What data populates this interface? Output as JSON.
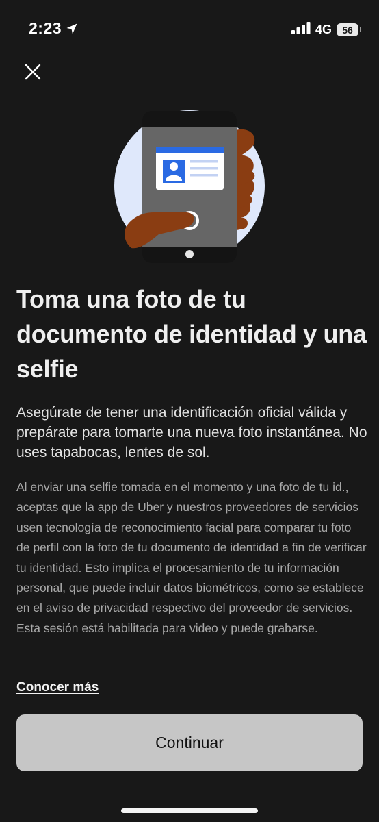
{
  "status_bar": {
    "time": "2:23",
    "network": "4G",
    "battery": "56",
    "icons": [
      "location-arrow-icon",
      "signal-bars-icon",
      "battery-icon"
    ]
  },
  "header": {
    "close_icon": "close-icon"
  },
  "illustration": {
    "subject": "phone-scanning-id-card",
    "colors": {
      "circle": "#dfe8fb",
      "phone_body": "#666666",
      "phone_frame": "#141414",
      "card_header": "#2a6ae3",
      "card_avatar": "#2a6ae3",
      "card_lines": "#c3d2f3",
      "hand": "#8a3d12"
    }
  },
  "content": {
    "title": "Toma una foto de tu documento de identidad y una selfie",
    "subtitle": "Asegúrate de tener una identificación oficial válida y prepárate para tomarte una nueva foto instantánea. No uses tapabocas, lentes de sol.",
    "legal": "Al enviar una selfie tomada en el momento y una foto de tu id., aceptas que la app de Uber y nuestros proveedores de servicios usen tecnología de reconocimiento facial para comparar tu foto de perfil con la foto de tu documento de identidad a fin de verificar tu identidad. Esto implica el procesamiento de tu información personal, que puede incluir datos biométricos, como se establece en el aviso de privacidad respectivo del proveedor de servicios. Esta sesión está habilitada para video y puede grabarse.",
    "learn_more": "Conocer más"
  },
  "actions": {
    "continue_label": "Continuar"
  },
  "theme": {
    "background": "#181818",
    "button_bg": "#c6c6c6",
    "button_text": "#111111"
  }
}
